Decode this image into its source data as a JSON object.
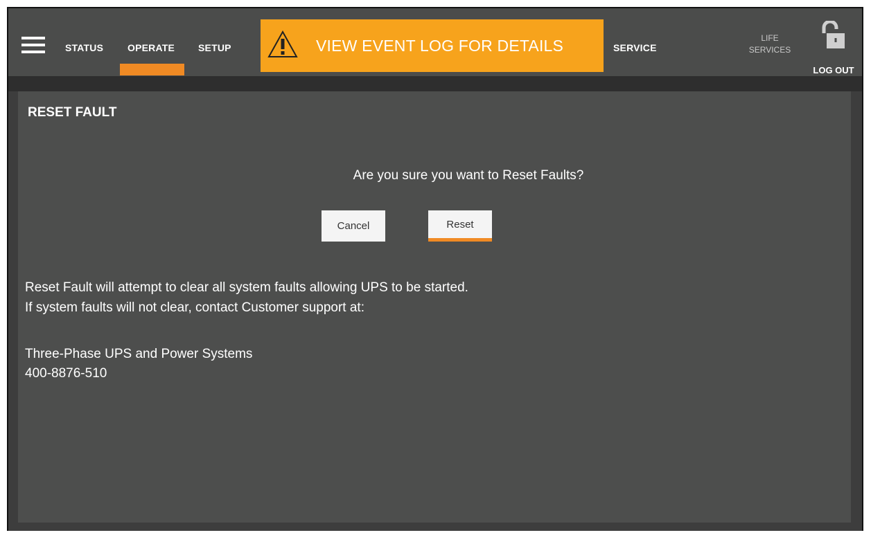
{
  "nav": {
    "status": "STATUS",
    "operate": "OPERATE",
    "setup": "SETUP",
    "service": "SERVICE",
    "life_services_line1": "LIFE",
    "life_services_line2": "SERVICES",
    "logout": "LOG OUT",
    "active_tab": "OPERATE"
  },
  "alert": {
    "text": "VIEW EVENT LOG FOR DETAILS",
    "icon": "warning-triangle-icon",
    "color": "#f7a31c"
  },
  "panel": {
    "title": "RESET FAULT",
    "question": "Are you sure you want to Reset Faults?",
    "cancel_label": "Cancel",
    "reset_label": "Reset",
    "info_line1": "Reset Fault will attempt to clear all system faults allowing UPS to be started.",
    "info_line2": "If system faults will not clear, contact Customer support at:",
    "contact_name": "Three-Phase UPS and Power Systems",
    "contact_phone": "400-8876-510"
  },
  "colors": {
    "accent": "#f08a24",
    "topbar": "#4b4c4b",
    "panel": "#4d4e4d"
  }
}
